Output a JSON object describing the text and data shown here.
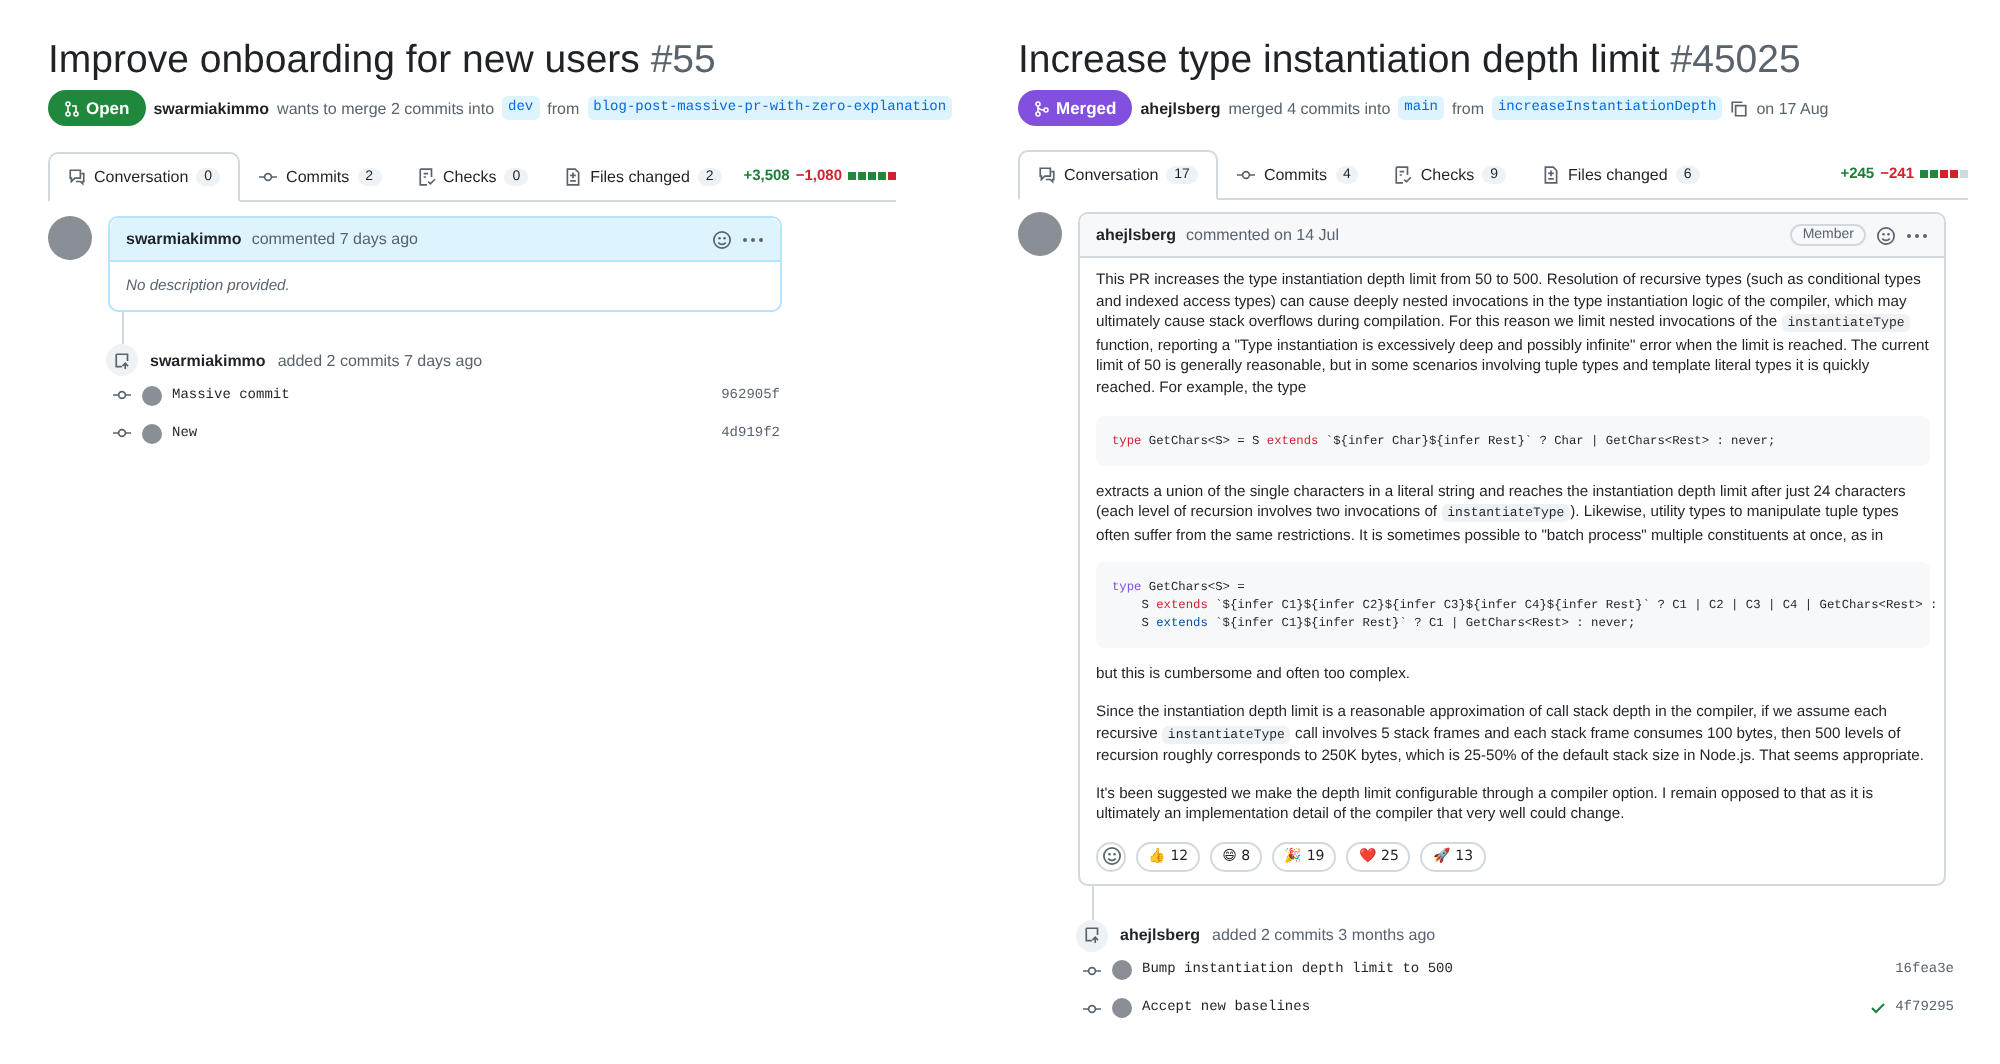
{
  "prs": [
    {
      "title": "Improve onboarding for new users",
      "number": "#55",
      "state": {
        "kind": "open",
        "label": "Open"
      },
      "author": "swarmiakimmo",
      "action": "wants to merge 2 commits into",
      "base": "dev",
      "from": "from",
      "head": "blog-post-massive-pr-with-zero-explanation",
      "tabs": [
        {
          "label": "Conversation",
          "count": "0",
          "selected": true
        },
        {
          "label": "Commits",
          "count": "2",
          "selected": false
        },
        {
          "label": "Checks",
          "count": "0",
          "selected": false
        },
        {
          "label": "Files changed",
          "count": "2",
          "selected": false
        }
      ],
      "diff": {
        "additions": "+3,508",
        "deletions": "−1,080",
        "blocks": [
          {
            "kind": "add"
          },
          {
            "kind": "add"
          },
          {
            "kind": "add"
          },
          {
            "kind": "add"
          },
          {
            "kind": "del"
          }
        ]
      },
      "comment": {
        "author": "swarmiakimmo",
        "meta": "commented 7 days ago",
        "highlighted": true,
        "empty_text": "No description provided."
      },
      "event": {
        "author": "swarmiakimmo",
        "text": "added 2 commits 7 days ago",
        "commits": [
          {
            "message": "Massive commit",
            "sha": "962905f",
            "passed": false
          },
          {
            "message": "New",
            "sha": "4d919f2",
            "passed": false
          }
        ]
      }
    },
    {
      "title": "Increase type instantiation depth limit",
      "number": "#45025",
      "state": {
        "kind": "merged",
        "label": "Merged"
      },
      "author": "ahejlsberg",
      "action": "merged 4 commits into",
      "base": "main",
      "from": "from",
      "head": "increaseInstantiationDepth",
      "date": "on 17 Aug",
      "tabs": [
        {
          "label": "Conversation",
          "count": "17",
          "selected": true
        },
        {
          "label": "Commits",
          "count": "4",
          "selected": false
        },
        {
          "label": "Checks",
          "count": "9",
          "selected": false
        },
        {
          "label": "Files changed",
          "count": "6",
          "selected": false
        }
      ],
      "diff": {
        "additions": "+245",
        "deletions": "−241",
        "blocks": [
          {
            "kind": "add"
          },
          {
            "kind": "add"
          },
          {
            "kind": "del"
          },
          {
            "kind": "del"
          },
          {
            "kind": "neutral"
          }
        ]
      },
      "comment": {
        "author": "ahejlsberg",
        "meta": "commented on 14 Jul",
        "highlighted": false,
        "role": "Member",
        "body": [
          {
            "kind": "paragraph",
            "segments": [
              {
                "kind": "text",
                "text": "This PR increases the type instantiation depth limit from 50 to 500. Resolution of recursive types (such as conditional types and indexed access types) can cause deeply nested invocations in the type instantiation logic of the compiler, which may ultimately cause stack overflows during compilation. For this reason we limit nested invocations of the "
              },
              {
                "kind": "code",
                "text": "instantiateType"
              },
              {
                "kind": "text",
                "text": " function, reporting a \"Type instantiation is excessively deep and possibly infinite\" error when the limit is reached. The current limit of 50 is generally reasonable, but in some scenarios involving tuple types and template literal types it is quickly reached. For example, the type"
              }
            ]
          },
          {
            "kind": "code_block",
            "lines": [
              [
                {
                  "kind": "keyword",
                  "text": "type"
                },
                {
                  "kind": "plain",
                  "text": " GetChars<S> = S "
                },
                {
                  "kind": "keyword",
                  "text": "extends"
                },
                {
                  "kind": "plain",
                  "text": " `${infer Char}${infer Rest}` ? Char | GetChars<Rest> : never;"
                }
              ]
            ]
          },
          {
            "kind": "paragraph",
            "segments": [
              {
                "kind": "text",
                "text": "extracts a union of the single characters in a literal string and reaches the instantiation depth limit after just 24 characters (each level of recursion involves two invocations of "
              },
              {
                "kind": "code",
                "text": "instantiateType"
              },
              {
                "kind": "text",
                "text": "). Likewise, utility types to manipulate tuple types often suffer from the same restrictions. It is sometimes possible to \"batch process\" multiple constituents at once, as in"
              }
            ]
          },
          {
            "kind": "code_block",
            "lines": [
              [
                {
                  "kind": "declaration",
                  "text": "type"
                },
                {
                  "kind": "plain",
                  "text": " GetChars<S> ="
                }
              ],
              [
                {
                  "kind": "plain",
                  "text": "    S "
                },
                {
                  "kind": "keyword",
                  "text": "extends"
                },
                {
                  "kind": "plain",
                  "text": " `${infer C1}${infer C2}${infer C3}${infer C4}${infer Rest}` ? C1 | C2 | C3 | C4 | GetChars<Rest> :"
                }
              ],
              [
                {
                  "kind": "plain",
                  "text": "    S "
                },
                {
                  "kind": "symbol",
                  "text": "extends"
                },
                {
                  "kind": "plain",
                  "text": " `${infer C1}${infer Rest}` ? C1 | GetChars<Rest> : never;"
                }
              ]
            ]
          },
          {
            "kind": "paragraph",
            "segments": [
              {
                "kind": "text",
                "text": "but this is cumbersome and often too complex."
              }
            ]
          },
          {
            "kind": "paragraph",
            "segments": [
              {
                "kind": "text",
                "text": "Since the instantiation depth limit is a reasonable approximation of call stack depth in the compiler, if we assume each recursive "
              },
              {
                "kind": "code",
                "text": "instantiateType"
              },
              {
                "kind": "text",
                "text": " call involves 5 stack frames and each stack frame consumes 100 bytes, then 500 levels of recursion roughly corresponds to 250K bytes, which is 25-50% of the default stack size in Node.js. That seems appropriate."
              }
            ]
          },
          {
            "kind": "paragraph",
            "segments": [
              {
                "kind": "text",
                "text": "It's been suggested we make the depth limit configurable through a compiler option. I remain opposed to that as it is ultimately an implementation detail of the compiler that very well could change."
              }
            ]
          }
        ],
        "reactions": [
          {
            "emoji": "👍",
            "count": "12"
          },
          {
            "emoji": "😄",
            "count": "8"
          },
          {
            "emoji": "🎉",
            "count": "19"
          },
          {
            "emoji": "❤️",
            "count": "25"
          },
          {
            "emoji": "🚀",
            "count": "13"
          }
        ]
      },
      "event": {
        "author": "ahejlsberg",
        "text": "added 2 commits 3 months ago",
        "commits": [
          {
            "message": "Bump instantiation depth limit to 500",
            "sha": "16fea3e",
            "passed": false
          },
          {
            "message": "Accept new baselines",
            "sha": "4f79295",
            "passed": true
          }
        ]
      }
    }
  ]
}
